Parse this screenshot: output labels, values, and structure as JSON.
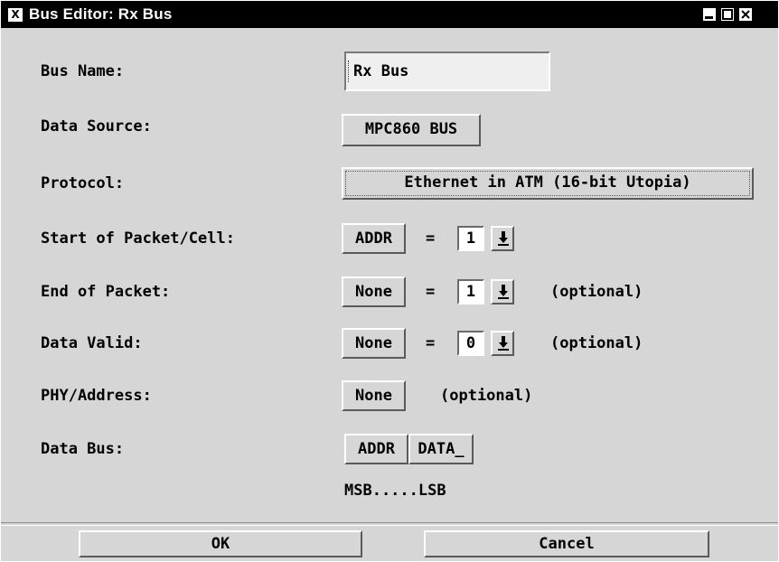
{
  "window": {
    "title": "Bus Editor: Rx Bus",
    "icon_letter": "X",
    "controls": [
      "minimize-icon",
      "maximize-icon",
      "close-icon"
    ]
  },
  "form": {
    "bus_name": {
      "label": "Bus Name:",
      "value": "Rx Bus"
    },
    "data_source": {
      "label": "Data Source:",
      "value": "MPC860 BUS"
    },
    "protocol": {
      "label": "Protocol:",
      "value": "Ethernet in ATM (16-bit Utopia)"
    },
    "start_of_packet": {
      "label": "Start of Packet/Cell:",
      "signal": "ADDR",
      "equals": "=",
      "value": "1"
    },
    "end_of_packet": {
      "label": "End of Packet:",
      "signal": "None",
      "equals": "=",
      "value": "1",
      "note": "(optional)"
    },
    "data_valid": {
      "label": "Data Valid:",
      "signal": "None",
      "equals": "=",
      "value": "0",
      "note": "(optional)"
    },
    "phy_address": {
      "label": "PHY/Address:",
      "signal": "None",
      "note": "(optional)"
    },
    "data_bus": {
      "label": "Data Bus:",
      "signals": [
        "ADDR",
        "DATA_"
      ],
      "order_label": "MSB.....LSB"
    }
  },
  "buttons": {
    "ok": "OK",
    "cancel": "Cancel"
  },
  "colors": {
    "background": "#d6d6d6",
    "titlebar": "#000000",
    "field": "#efefef"
  }
}
